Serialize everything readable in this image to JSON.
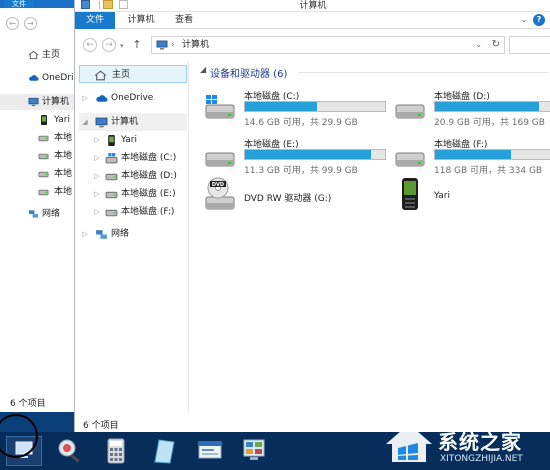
{
  "main_window": {
    "title": "计算机",
    "ribbon_tabs": [
      "文件",
      "计算机",
      "查看"
    ],
    "address_path": "计算机",
    "nav_pane": {
      "home": "主页",
      "onedrive": "OneDrive",
      "computer": "计算机",
      "children": [
        "Yari",
        "本地磁盘 (C:)",
        "本地磁盘 (D:)",
        "本地磁盘 (E:)",
        "本地磁盘 (F:)"
      ],
      "network": "网络"
    },
    "group_header": "设备和驱动器 (6)",
    "drives": [
      {
        "name": "本地磁盘 (C:)",
        "free": "14.6 GB 可用，共 29.9 GB",
        "used_fraction": 0.51
      },
      {
        "name": "本地磁盘 (D:)",
        "free": "20.9 GB 可用，共 169 GB",
        "used_fraction": 0.88
      },
      {
        "name": "本地磁盘 (E:)",
        "free": "11.3 GB 可用，共 99.9 GB",
        "used_fraction": 0.89
      },
      {
        "name": "本地磁盘 (F:)",
        "free": "118 GB 可用，共 334 GB",
        "used_fraction": 0.65
      }
    ],
    "devices": [
      {
        "name": "DVD RW 驱动器 (G:)",
        "icon": "dvd-drive-icon"
      },
      {
        "name": "Yari",
        "icon": "phone-icon"
      }
    ],
    "status": "6 个项目"
  },
  "background_window": {
    "file_tab": "文件",
    "nav_items": [
      "主页",
      "OneDrive",
      "计算机",
      "Yari",
      "本地",
      "本地",
      "本地",
      "本地",
      "网络"
    ],
    "status": "6 个项目"
  },
  "watermark": {
    "text": "系统之家",
    "sub": "XITONGZHIJIA.NET"
  },
  "colors": {
    "accent": "#1979ca",
    "drive_bar": "#26a0da",
    "selection": "#e5f3fb"
  }
}
